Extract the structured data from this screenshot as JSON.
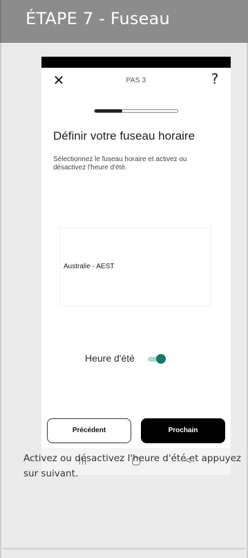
{
  "step_header": {
    "title": "ÉTAPE 7 - Fuseau"
  },
  "phone": {
    "top_bar": {
      "close_icon": "close-icon",
      "step_label": "PAS 3",
      "help_label": "?"
    },
    "progress": {
      "value_fraction": 0.33
    },
    "heading": "Définir votre fuseau horaire",
    "description": "Sélectionnez le fuseau horaire et activez ou désactivez l'heure d'été.",
    "timezone": {
      "selected": "Australie - AEST"
    },
    "dst": {
      "label": "Heure d'été",
      "enabled": true,
      "color_on": "#127a68"
    },
    "buttons": {
      "previous": "Précédent",
      "next": "Prochain"
    },
    "nav": {
      "recent_icon": "recent-apps-icon",
      "home_icon": "home-icon",
      "back_icon": "back-icon",
      "back_glyph": "<"
    }
  },
  "instruction": "Activez ou désactivez l'heure d'été et appuyez sur suivant."
}
